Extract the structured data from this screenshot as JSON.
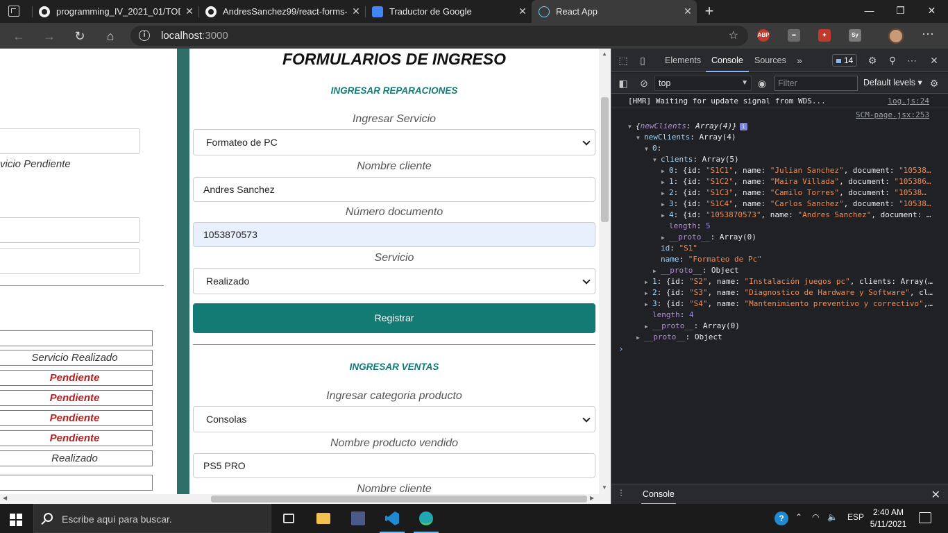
{
  "browser": {
    "tabs": [
      {
        "title": "programming_IV_2021_01/TODO",
        "favicon": "github-icon",
        "active": false
      },
      {
        "title": "AndresSanchez99/react-forms-co",
        "favicon": "github-icon",
        "active": false
      },
      {
        "title": "Traductor de Google",
        "favicon": "google-translate-icon",
        "active": false
      },
      {
        "title": "React App",
        "favicon": "react-icon",
        "active": true
      }
    ],
    "address": {
      "host": "localhost",
      "port": ":3000"
    },
    "extensions": [
      {
        "name": "ABP",
        "color": "#c0392b"
      },
      {
        "name": "",
        "color": "#6b6b6b"
      },
      {
        "name": "",
        "color": "#c0392b"
      },
      {
        "name": "Sy",
        "color": "#7a7a7a"
      }
    ]
  },
  "left_panel": {
    "status_text": "vicio Pendiente",
    "rows": [
      {
        "text": "",
        "style": "normal"
      },
      {
        "text": "Servicio Realizado",
        "style": "normal"
      },
      {
        "text": "Pendiente",
        "style": "red"
      },
      {
        "text": "Pendiente",
        "style": "red"
      },
      {
        "text": "Pendiente",
        "style": "red"
      },
      {
        "text": "Pendiente",
        "style": "red"
      },
      {
        "text": "Realizado",
        "style": "normal"
      },
      {
        "text": "",
        "style": "normal"
      }
    ]
  },
  "form": {
    "title": "FORMULARIOS DE INGRESO",
    "repairs": {
      "heading": "INGRESAR REPARACIONES",
      "service_label": "Ingresar Servicio",
      "service_value": "Formateo de PC",
      "client_label": "Nombre cliente",
      "client_value": "Andres Sanchez",
      "document_label": "Número documento",
      "document_value": "1053870573",
      "status_label": "Servicio",
      "status_value": "Realizado",
      "submit_label": "Registrar"
    },
    "sales": {
      "heading": "INGRESAR VENTAS",
      "category_label": "Ingresar categoria producto",
      "category_value": "Consolas",
      "product_label": "Nombre producto vendido",
      "product_value": "PS5 PRO",
      "client_label": "Nombre cliente"
    }
  },
  "devtools": {
    "tabs": [
      "Elements",
      "Console",
      "Sources"
    ],
    "active_tab": "Console",
    "issues_count": "14",
    "context": "top",
    "filter_placeholder": "Filter",
    "levels": "Default levels",
    "hmr_message": "[HMR] Waiting for update signal from WDS...",
    "hmr_source": "log.js:24",
    "object_source": "SCM-page.jsx:253",
    "drawer_tab": "Console"
  },
  "taskbar": {
    "search_placeholder": "Escribe aquí para buscar.",
    "language": "ESP",
    "time": "2:40 AM",
    "date": "5/11/2021"
  }
}
